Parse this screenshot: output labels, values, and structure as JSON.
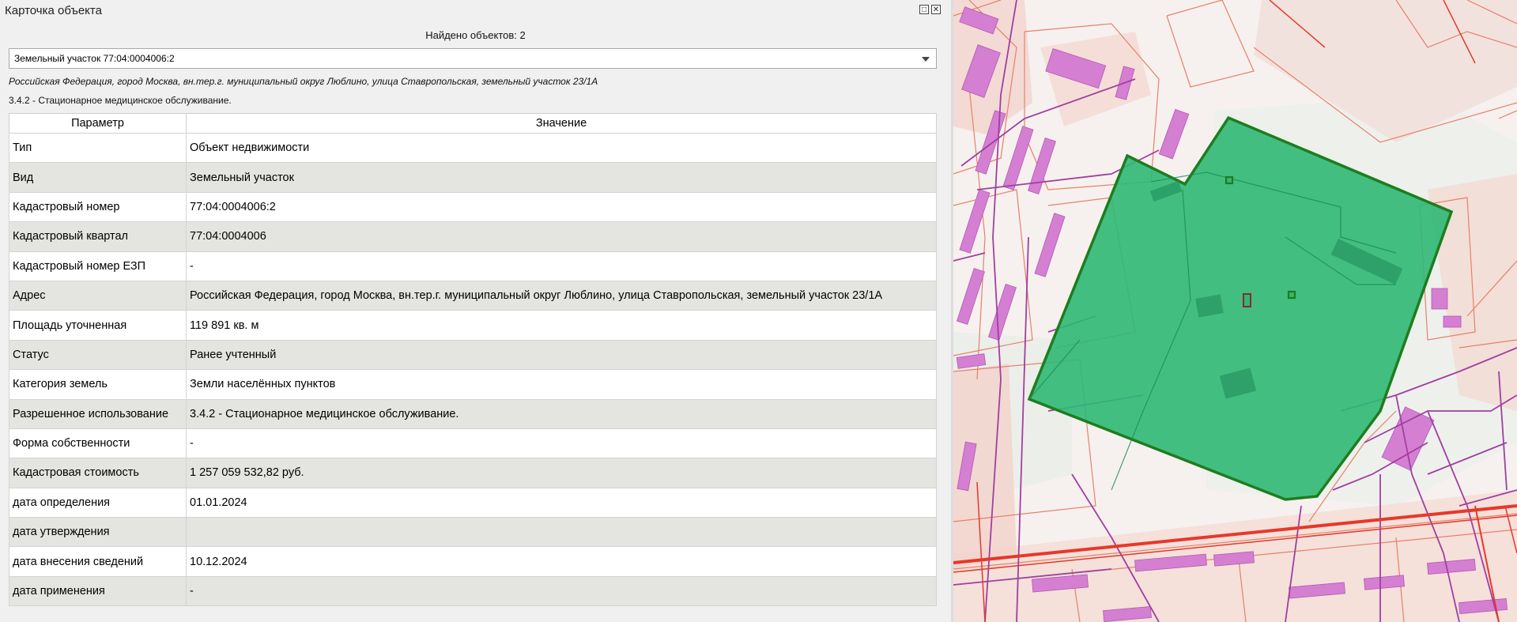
{
  "window": {
    "title": "Карточка объекта",
    "restore_icon": "restore-icon",
    "close_icon": "close-icon"
  },
  "found_label": "Найдено объектов: 2",
  "selected_object": "Земельный участок 77:04:0004006:2",
  "address_line": "Российская Федерация, город Москва, вн.тер.г. муниципальный округ Люблино, улица Ставропольская, земельный участок 23/1А",
  "use_line": "3.4.2 - Стационарное медицинское обслуживание.",
  "table": {
    "headers": [
      "Параметр",
      "Значение"
    ],
    "rows": [
      [
        "Тип",
        "Объект недвижимости"
      ],
      [
        "Вид",
        "Земельный участок"
      ],
      [
        "Кадастровый номер",
        "77:04:0004006:2"
      ],
      [
        "Кадастровый квартал",
        "77:04:0004006"
      ],
      [
        "Кадастровый номер ЕЗП",
        "-"
      ],
      [
        "Адрес",
        "Российская Федерация, город Москва, вн.тер.г. муниципальный округ Люблино, улица Ставропольская, земельный участок 23/1А"
      ],
      [
        "Площадь уточненная",
        "119 891 кв. м"
      ],
      [
        "Статус",
        "Ранее учтенный"
      ],
      [
        "Категория земель",
        "Земли населённых пунктов"
      ],
      [
        "Разрешенное использование",
        "3.4.2 - Стационарное медицинское обслуживание."
      ],
      [
        "Форма собственности",
        "-"
      ],
      [
        "Кадастровая стоимость",
        "1 257 059 532,82 руб."
      ],
      [
        "дата определения",
        "01.01.2024"
      ],
      [
        "дата утверждения",
        ""
      ],
      [
        "дата внесения сведений",
        "10.12.2024"
      ],
      [
        "дата применения",
        "-"
      ]
    ]
  },
  "map": {
    "colors": {
      "background": "#f6f1ee",
      "parcel_outline": "#e8806a",
      "building_fill": "#d57fd3",
      "network_line": "#a03fa0",
      "road_line": "#e5392a",
      "selected_fill": "#2fb874",
      "selected_outline": "#1e7d1e"
    }
  }
}
